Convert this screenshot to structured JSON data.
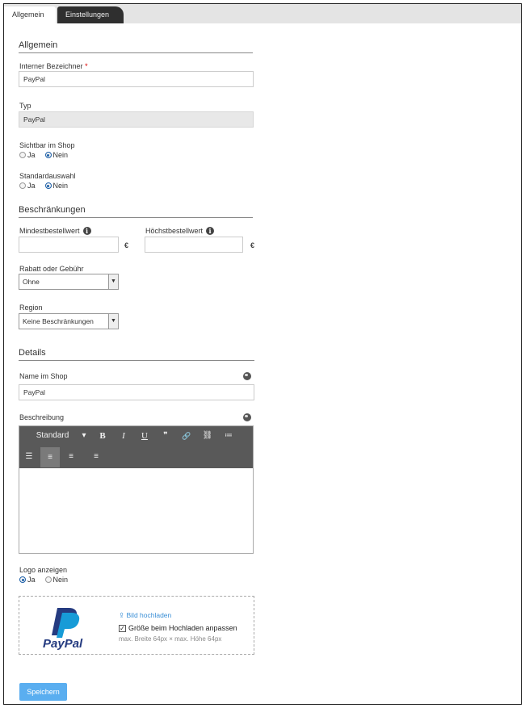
{
  "tabs": [
    {
      "label": "Allgemein"
    },
    {
      "label": "Einstellungen"
    }
  ],
  "sections": {
    "allgemein": "Allgemein",
    "beschraenkungen": "Beschränkungen",
    "details": "Details"
  },
  "fields": {
    "internal_name_label": "Interner Bezeichner",
    "required_mark": "*",
    "internal_name_value": "PayPal",
    "type_label": "Typ",
    "type_value": "PayPal",
    "visible_label": "Sichtbar im Shop",
    "visible_options": [
      "Ja",
      "Nein"
    ],
    "visible_selected": "Nein",
    "default_label": "Standardauswahl",
    "default_options": [
      "Ja",
      "Nein"
    ],
    "default_selected": "Nein",
    "min_order_label": "Mindestbestellwert",
    "max_order_label": "Höchstbestellwert",
    "currency": "€",
    "discount_label": "Rabatt oder Gebühr",
    "discount_value": "Ohne",
    "region_label": "Region",
    "region_value": "Keine Beschränkungen",
    "shop_name_label": "Name im Shop",
    "shop_name_value": "PayPal",
    "description_label": "Beschreibung",
    "logo_label": "Logo anzeigen",
    "logo_options": [
      "Ja",
      "Nein"
    ],
    "logo_selected": "Ja"
  },
  "editor": {
    "format_label": "Standard",
    "format_arrow": "▾",
    "bold": "B",
    "italic": "I",
    "underline": "U",
    "quote": "❞",
    "link": "🔗",
    "unlink": "⛓",
    "ordered_list": "≔",
    "unordered_list": "☰",
    "align_left": "≡",
    "align_center": "≡",
    "align_right": "≡"
  },
  "upload": {
    "logo_text": "PayPal",
    "upload_link": "Bild hochladen",
    "upload_icon": "⇪",
    "resize_label": "Größe beim Hochladen anpassen",
    "resize_checked": true,
    "max_size_hint": "max. Breite 64px × max. Höhe 64px"
  },
  "actions": {
    "save_label": "Speichern"
  },
  "colors": {
    "accent": "#5aaef0",
    "link": "#3a8fd6",
    "toolbar": "#595959",
    "required": "#dd0000",
    "paypal_dark": "#253b80",
    "paypal_light": "#179bd7"
  }
}
